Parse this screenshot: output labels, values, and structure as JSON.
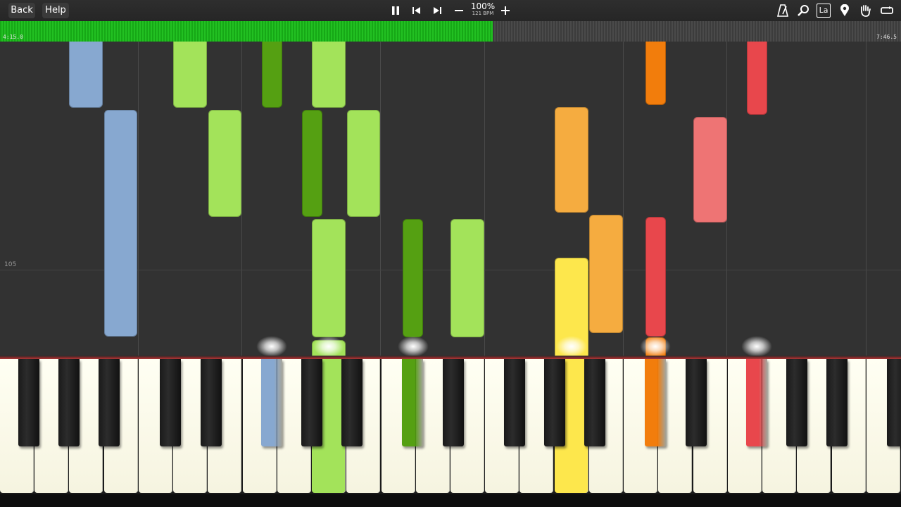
{
  "toolbar": {
    "back_label": "Back",
    "help_label": "Help",
    "speed_percent": "100%",
    "tempo": "121 BPM",
    "icons": [
      "pause-icon",
      "previous-icon",
      "next-icon",
      "minus-icon",
      "plus-icon",
      "metronome-icon",
      "magnifier-icon",
      "label-icon",
      "marker-icon",
      "hand-icon",
      "loop-icon"
    ],
    "label_icon_text": "La"
  },
  "timeline": {
    "current_time": "4:15.0",
    "total_time": "7:46.5",
    "progress": 0.547,
    "progress_color": "#1fb81f"
  },
  "piano_roll": {
    "measure_number": "105",
    "colors": {
      "blue": "#87a8d0",
      "light_green": "#a3e35a",
      "dark_green": "#55a012",
      "orange": "#f5ac40",
      "dark_orange": "#f27d0c",
      "yellow": "#fde74c",
      "red": "#e8474c",
      "pink": "#ee7474"
    }
  },
  "keyboard": {
    "pressed_keys": [
      "blue",
      "light_green",
      "dark_green",
      "yellow",
      "dark_orange",
      "red"
    ]
  }
}
